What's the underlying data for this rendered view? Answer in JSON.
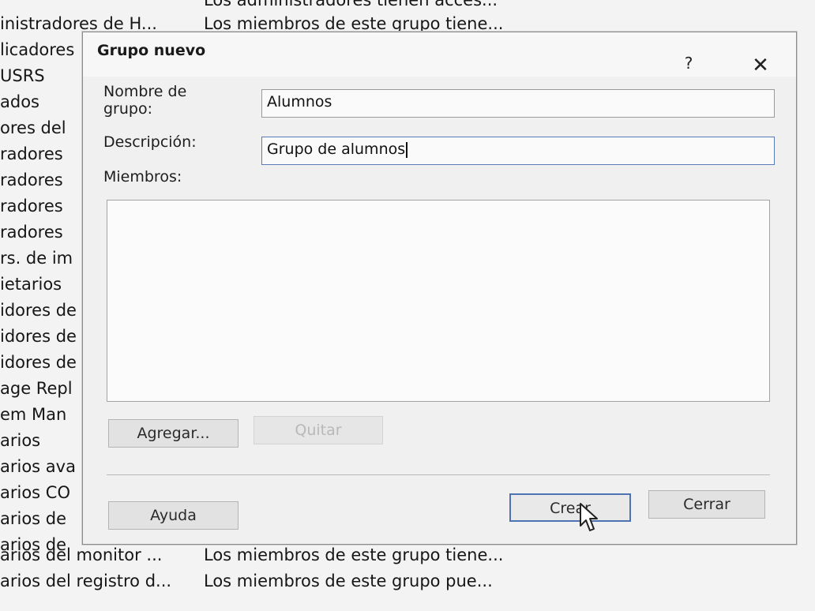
{
  "background_list": {
    "top_row": {
      "name": "",
      "desc": "Los administradores tienen acces..."
    },
    "rows": [
      {
        "name": "inistradores de H...",
        "desc": "Los miembros de este grupo tiene..."
      },
      {
        "name": "licadores"
      },
      {
        "name": "USRS"
      },
      {
        "name": "ados"
      },
      {
        "name": "ores del"
      },
      {
        "name": "radores"
      },
      {
        "name": "radores"
      },
      {
        "name": "radores"
      },
      {
        "name": "radores"
      },
      {
        "name": "rs. de im"
      },
      {
        "name": "ietarios"
      },
      {
        "name": "idores de"
      },
      {
        "name": "idores de"
      },
      {
        "name": "idores de"
      },
      {
        "name": "age Repl"
      },
      {
        "name": "em Man"
      },
      {
        "name": "arios"
      },
      {
        "name": "arios ava"
      },
      {
        "name": "arios CO"
      },
      {
        "name": "arios de"
      },
      {
        "name": "arios de"
      },
      {
        "name": "arios del monitor ...",
        "desc": "Los miembros de este grupo tiene..."
      },
      {
        "name": "arios del registro d...",
        "desc": "Los miembros de este grupo pue..."
      }
    ]
  },
  "dialog": {
    "title": "Grupo nuevo",
    "help_symbol": "?",
    "close_symbol": "✕",
    "labels": {
      "group_name": "Nombre de grupo:",
      "description": "Descripción:",
      "members": "Miembros:"
    },
    "fields": {
      "group_name_value": "Alumnos",
      "description_value": "Grupo de alumnos"
    },
    "buttons": {
      "add": "Agregar...",
      "remove": "Quitar",
      "help": "Ayuda",
      "create": "Crear",
      "close": "Cerrar"
    }
  },
  "icons": {
    "cursor": "mouse-pointer-icon"
  }
}
